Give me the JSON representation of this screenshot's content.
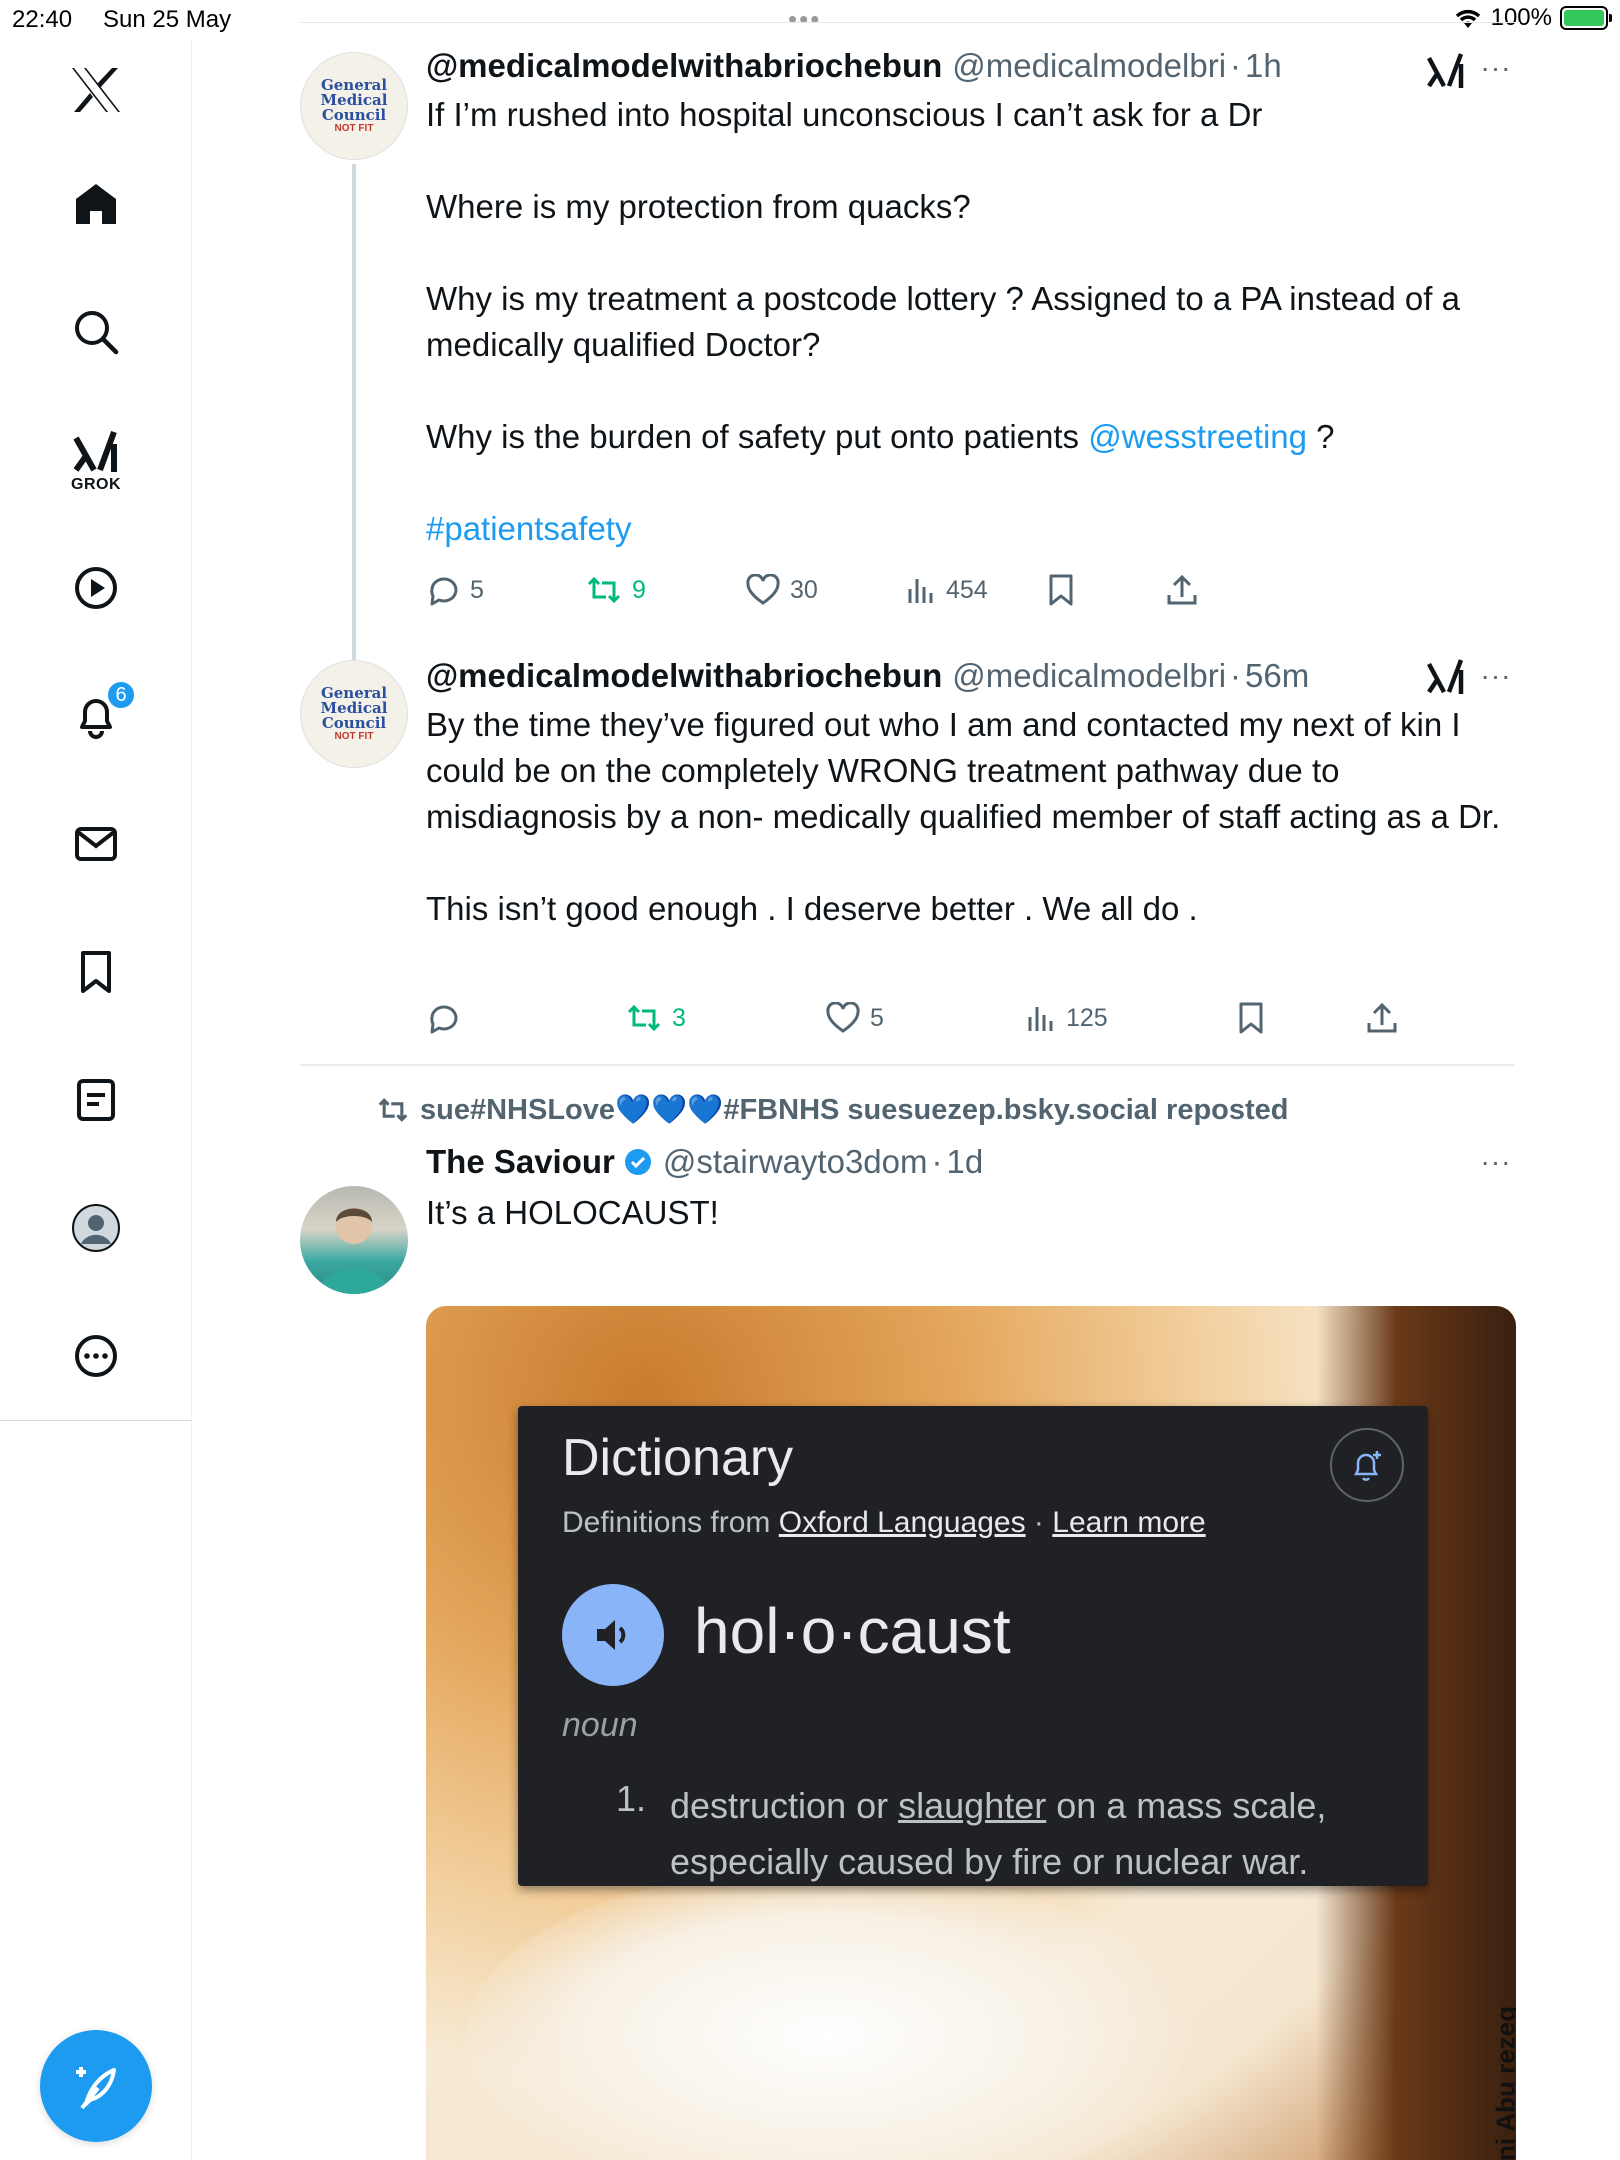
{
  "status_bar": {
    "time": "22:40",
    "date": "Sun 25 May",
    "battery": "100%"
  },
  "sidebar": {
    "grok_label": "GROK",
    "notification_count": "6"
  },
  "tweets": [
    {
      "author": "@medicalmodelwithabriochebun",
      "handle": "@medicalmodelbri",
      "time": "1h",
      "avatar_text": [
        "General",
        "Medical",
        "Council",
        "NOT FIT"
      ],
      "text_parts": {
        "p1": "If I’m rushed into hospital unconscious I can’t ask for a Dr\n\nWhere is my protection from quacks?\n\nWhy is my treatment a postcode lottery ? Assigned to a PA instead of a medically qualified Doctor?\n\nWhy is the burden of safety put onto patients ",
        "mention": "@wesstreeting",
        "p2": " ?\n\n",
        "hashtag": "#patientsafety"
      },
      "stats": {
        "replies": "5",
        "reposts": "9",
        "likes": "30",
        "views": "454"
      }
    },
    {
      "author": "@medicalmodelwithabriochebun",
      "handle": "@medicalmodelbri",
      "time": "56m",
      "avatar_text": [
        "General",
        "Medical",
        "Council",
        "NOT FIT"
      ],
      "text": "By the time they’ve figured out who I am and contacted my next of kin I could be on the completely WRONG treatment pathway due to misdiagnosis by a non- medically qualified member of staff acting as a Dr.\n\nThis isn’t good enough . I deserve better . We all do .",
      "stats": {
        "replies": "",
        "reposts": "3",
        "likes": "5",
        "views": "125"
      }
    },
    {
      "reposted_by_prefix": "sue#NHSLove",
      "reposted_by_hearts": "💙💙💙",
      "reposted_by_suffix": "#FBNHS suesuezep.bsky.social reposted",
      "author": "The Saviour",
      "handle": "@stairwayto3dom",
      "time": "1d",
      "text": "It’s a HOLOCAUST!",
      "media": {
        "dictionary_title": "Dictionary",
        "source_prefix": "Definitions from ",
        "source_link": "Oxford Languages",
        "source_sep": " · ",
        "learn_more": "Learn more",
        "word": "hol·o·caust",
        "part_of_speech": "noun",
        "def_number": "1.",
        "def_part1": "destruction or ",
        "def_link": "slaughter",
        "def_part2": " on a mass scale, especially caused by fire or nuclear war.",
        "watermark": "hani Abu rezeq"
      }
    }
  ],
  "colors": {
    "accent": "#1d9bf0",
    "repost_green": "#00ba7c",
    "secondary_text": "#536471"
  }
}
